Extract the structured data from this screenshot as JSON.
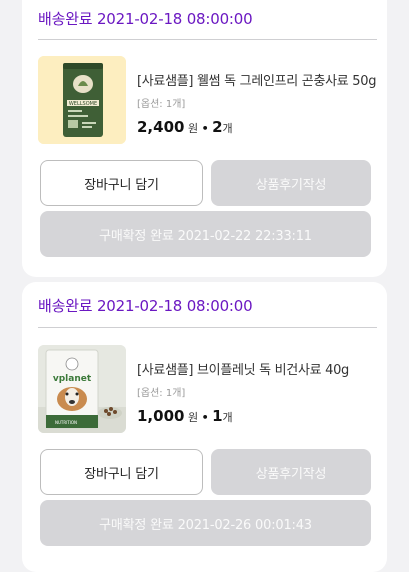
{
  "orders": [
    {
      "status": "배송완료 2021-02-18 08:00:00",
      "product": {
        "name": "[사료샘플] 웰썸 독 그레인프리 곤충사료 50g",
        "option": "[옵션: 1개]",
        "price": "2,400",
        "price_unit": "원",
        "separator": "•",
        "qty": "2",
        "qty_unit": "개",
        "package_brand": "WELLSOME"
      },
      "buttons": {
        "cart": "장바구니 담기",
        "review": "상품후기작성",
        "confirm": "구매확정 완료 2021-02-22 22:33:11"
      }
    },
    {
      "status": "배송완료 2021-02-18 08:00:00",
      "product": {
        "name": "[사료샘플] 브이플레닛 독 비건사료 40g",
        "option": "[옵션: 1개]",
        "price": "1,000",
        "price_unit": "원",
        "separator": "•",
        "qty": "1",
        "qty_unit": "개",
        "package_brand": "vplanet",
        "package_label": "NUTRITION"
      },
      "buttons": {
        "cart": "장바구니 담기",
        "review": "상품후기작성",
        "confirm": "구매확정 완료 2021-02-26 00:01:43"
      }
    }
  ],
  "colors": {
    "status": "#6b18c2",
    "disabled_button": "#d5d5d8",
    "background": "#f2f2f4"
  }
}
